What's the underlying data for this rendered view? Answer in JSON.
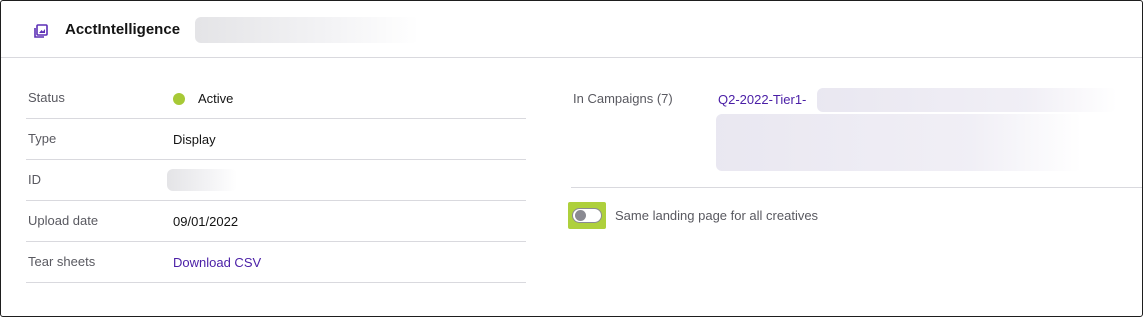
{
  "header": {
    "title": "AcctIntelligence",
    "icon": "image-gallery-icon"
  },
  "details": [
    {
      "label": "Status",
      "value": "Active"
    },
    {
      "label": "Type",
      "value": "Display"
    },
    {
      "label": "ID",
      "value": ""
    },
    {
      "label": "Upload date",
      "value": "09/01/2022"
    },
    {
      "label": "Tear sheets",
      "value": "Download CSV"
    }
  ],
  "campaigns": {
    "label": "In Campaigns (7)",
    "first_link": "Q2-2022-Tier1-"
  },
  "landing_toggle": {
    "label": "Same landing page for all creatives",
    "checked": false
  },
  "colors": {
    "accent": "#4a1ea6",
    "status_active": "#a7c936",
    "highlight": "#aed03c"
  }
}
